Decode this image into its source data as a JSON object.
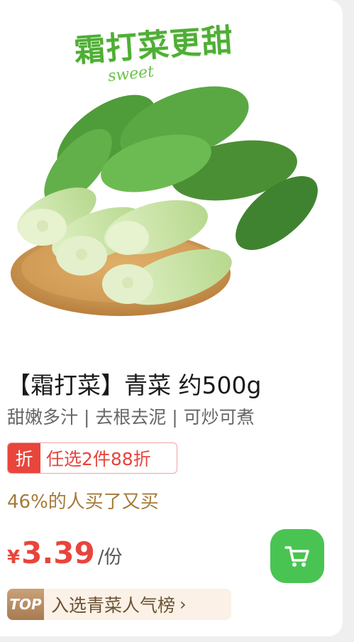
{
  "product": {
    "slogan": "霜打菜更甜",
    "slogan_sub": "sweet",
    "title": "【霜打菜】青菜 约500g",
    "subtitle": "甜嫩多汁 | 去根去泥 | 可炒可煮",
    "promo_tag": "折",
    "promo_text": "任选2件88折",
    "rebuy_text": "46%的人买了又买",
    "price_symbol": "¥",
    "price_value": "3.39",
    "price_unit": "/份",
    "rank_badge": "TOP",
    "rank_text": "入选青菜人气榜",
    "rank_chevron": "›"
  },
  "colors": {
    "accent_green": "#49c452",
    "price_red": "#e8453c",
    "rebuy_gold": "#a57a3a"
  },
  "icons": {
    "cart": "cart-icon",
    "chevron": "chevron-right-icon"
  }
}
